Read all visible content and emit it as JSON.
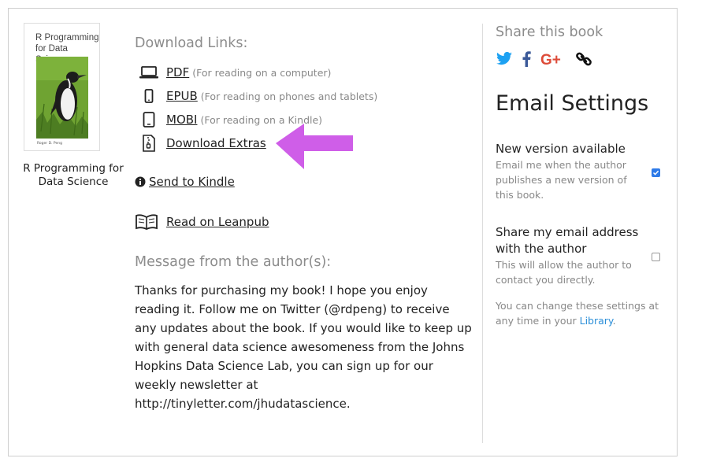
{
  "book": {
    "cover_title": "R Programming for Data Science",
    "cover_author": "Roger D. Peng",
    "title": "R Programming for Data Science"
  },
  "downloads": {
    "heading": "Download Links:",
    "items": [
      {
        "label": "PDF",
        "note": "(For reading on a computer)",
        "icon": "laptop-icon"
      },
      {
        "label": "EPUB",
        "note": "(For reading on phones and tablets)",
        "icon": "phone-icon"
      },
      {
        "label": "MOBI",
        "note": "(For reading on a Kindle)",
        "icon": "tablet-icon"
      },
      {
        "label": "Download Extras",
        "note": "",
        "icon": "zip-file-icon"
      }
    ],
    "send_to_kindle": "Send to Kindle",
    "read_on_leanpub": "Read on Leanpub"
  },
  "message": {
    "heading": "Message from the author(s):",
    "lines": [
      "Thanks for purchasing my book! I hope you enjoy",
      "reading it. Follow me on Twitter (@rdpeng) to receive",
      "any updates about the book. If you would like to keep up",
      "with general data science awesomeness from the Johns",
      "Hopkins Data Science Lab, you can sign up for our",
      "weekly newsletter at",
      "http://tinyletter.com/jhudatascience."
    ]
  },
  "share": {
    "heading": "Share this book",
    "icons": [
      "twitter-icon",
      "facebook-icon",
      "google-plus-icon",
      "link-icon"
    ]
  },
  "email_settings": {
    "heading": "Email Settings",
    "new_version": {
      "title": "New version available",
      "desc": "Email me when the author publishes a new version of this book.",
      "checked": true
    },
    "share_email": {
      "title": "Share my email address with the author",
      "desc": "This will allow the author to contact you directly.",
      "checked": false
    },
    "footer_text": "You can change these settings at any time in your ",
    "footer_link": "Library",
    "footer_end": "."
  },
  "colors": {
    "accent_arrow": "#cf5ee8",
    "twitter": "#1da1f2",
    "facebook": "#3b5998",
    "google_plus": "#dd4b39",
    "link": "#2a8ed8",
    "checkbox": "#2f7be8"
  }
}
